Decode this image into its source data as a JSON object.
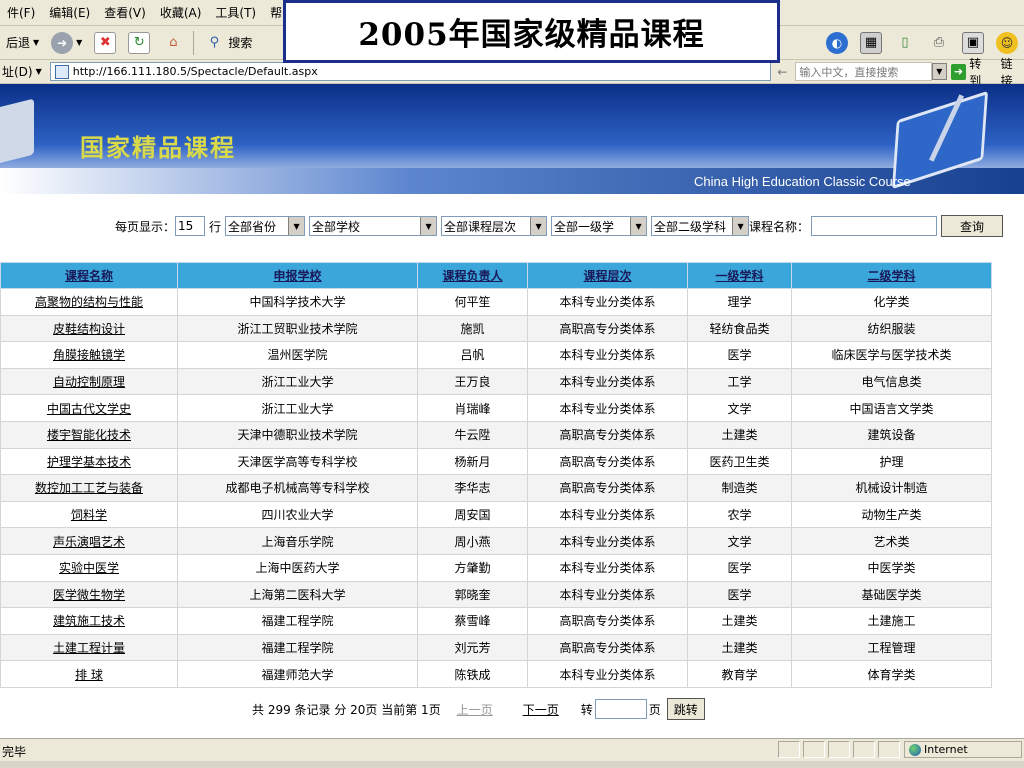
{
  "window": {
    "menu": [
      "件(F)",
      "编辑(E)",
      "查看(V)",
      "收藏(A)",
      "工具(T)",
      "帮"
    ],
    "toolbar": {
      "back": "后退",
      "search": "搜索"
    },
    "address": {
      "label": "址(D)",
      "url": "http://166.111.180.5/Spectacle/Default.aspx",
      "search_hint": "输入中文，直接搜索",
      "go": "转到",
      "links": "链接"
    }
  },
  "overlay_title": "2005年国家级精品课程",
  "banner": {
    "title": "国家精品课程",
    "subtitle": "China High Education Classic Course"
  },
  "filters": {
    "per_page_label": "每页显示：",
    "per_page_value": "15",
    "row_unit": "行",
    "province": "全部省份",
    "school": "全部学校",
    "level": "全部课程层次",
    "subject1": "全部一级学",
    "subject2": "全部二级学科",
    "course_name_label": "课程名称：",
    "course_name_value": "",
    "query_button": "查询"
  },
  "table": {
    "headers": [
      "课程名称",
      "申报学校",
      "课程负责人",
      "课程层次",
      "一级学科",
      "二级学科"
    ],
    "rows": [
      [
        "高聚物的结构与性能",
        "中国科学技术大学",
        "何平笙",
        "本科专业分类体系",
        "理学",
        "化学类"
      ],
      [
        "皮鞋结构设计",
        "浙江工贸职业技术学院",
        "施凯",
        "高职高专分类体系",
        "轻纺食品类",
        "纺织服装"
      ],
      [
        "角膜接触镜学",
        "温州医学院",
        "吕帆",
        "本科专业分类体系",
        "医学",
        "临床医学与医学技术类"
      ],
      [
        "自动控制原理",
        "浙江工业大学",
        "王万良",
        "本科专业分类体系",
        "工学",
        "电气信息类"
      ],
      [
        "中国古代文学史",
        "浙江工业大学",
        "肖瑞峰",
        "本科专业分类体系",
        "文学",
        "中国语言文学类"
      ],
      [
        "楼宇智能化技术",
        "天津中德职业技术学院",
        "牛云陞",
        "高职高专分类体系",
        "土建类",
        "建筑设备"
      ],
      [
        "护理学基本技术",
        "天津医学高等专科学校",
        "杨新月",
        "高职高专分类体系",
        "医药卫生类",
        "护理"
      ],
      [
        "数控加工工艺与装备",
        "成都电子机械高等专科学校",
        "李华志",
        "高职高专分类体系",
        "制造类",
        "机械设计制造"
      ],
      [
        "饲料学",
        "四川农业大学",
        "周安国",
        "本科专业分类体系",
        "农学",
        "动物生产类"
      ],
      [
        "声乐演唱艺术",
        "上海音乐学院",
        "周小燕",
        "本科专业分类体系",
        "文学",
        "艺术类"
      ],
      [
        "实验中医学",
        "上海中医药大学",
        "方肇勤",
        "本科专业分类体系",
        "医学",
        "中医学类"
      ],
      [
        "医学微生物学",
        "上海第二医科大学",
        "郭晓奎",
        "本科专业分类体系",
        "医学",
        "基础医学类"
      ],
      [
        "建筑施工技术",
        "福建工程学院",
        "蔡雪峰",
        "高职高专分类体系",
        "土建类",
        "土建施工"
      ],
      [
        "土建工程计量",
        "福建工程学院",
        "刘元芳",
        "高职高专分类体系",
        "土建类",
        "工程管理"
      ],
      [
        "排 球",
        "福建师范大学",
        "陈铁成",
        "本科专业分类体系",
        "教育学",
        "体育学类"
      ]
    ]
  },
  "pager": {
    "summary": "共 299 条记录 分 20页 当前第 1页",
    "prev": "上一页",
    "next": "下一页",
    "goto_label": "转",
    "page_unit": "页",
    "jump_button": "跳转"
  },
  "status": {
    "text": "完毕",
    "zone": "Internet"
  }
}
